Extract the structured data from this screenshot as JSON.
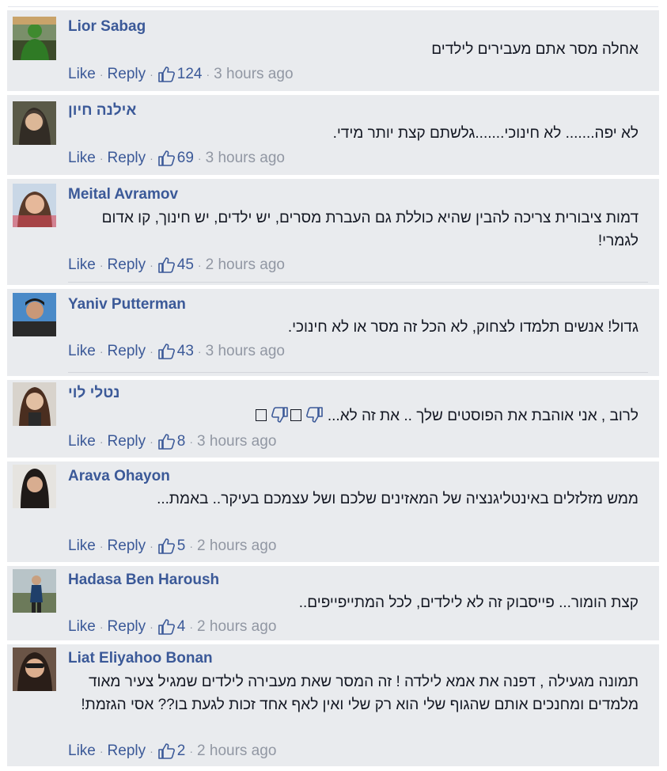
{
  "actions": {
    "like": "Like",
    "reply": "Reply",
    "separator": "·"
  },
  "comments": [
    {
      "name": "Lior Sabag",
      "text": "אחלה מסר אתם מעבירים לילדים",
      "likes": "124",
      "time": "3 hours ago"
    },
    {
      "name": "אילנה חיון",
      "text": "לא יפה....... לא חינוכי.......גלשתם קצת יותר מידי.",
      "likes": "69",
      "time": "3 hours ago"
    },
    {
      "name": "Meital Avramov",
      "text": "דמות ציבורית צריכה להבין שהיא כוללת גם העברת מסרים, יש ילדים, יש חינוך, קו אדום לגמרי!",
      "likes": "45",
      "time": "2 hours ago"
    },
    {
      "name": "Yaniv Putterman",
      "text": "גדול! אנשים תלמדו לצחוק, לא הכל זה מסר או לא חינוכי.",
      "likes": "43",
      "time": "3 hours ago"
    },
    {
      "name": "נטלי לוי",
      "text": "לרוב , אני אוהבת את הפוסטים שלך .. את זה לא...",
      "likes": "8",
      "time": "3 hours ago"
    },
    {
      "name": "Arava Ohayon",
      "text": "ממש מזלזלים באינטליגנציה של המאזינים שלכם ושל עצמכם בעיקר.. באמת...",
      "likes": "5",
      "time": "2 hours ago"
    },
    {
      "name": "Hadasa Ben Haroush",
      "text": "קצת הומור... פייסבוק זה לא לילדים, לכל המתייפייפים..",
      "likes": "4",
      "time": "2 hours ago"
    },
    {
      "name": "Liat Eliyahoo Bonan",
      "text": "תמונה מגעילה , דפנה את אמא לילדה ! זה המסר שאת מעבירה לילדים שמגיל צעיר מאוד מלמדים ומחנכים אותם שהגוף שלי הוא רק שלי ואין לאף אחד זכות לגעת בו?? אסי הגזמת!",
      "likes": "2",
      "time": "2 hours ago"
    }
  ],
  "colors": {
    "name": "#3b5998",
    "background": "#e9ebee",
    "text": "#141823",
    "meta": "#9197a3"
  },
  "icons": {
    "like": "thumbs-up-icon",
    "dislike": "thumbs-down-icon",
    "box": "missing-glyph-box"
  }
}
